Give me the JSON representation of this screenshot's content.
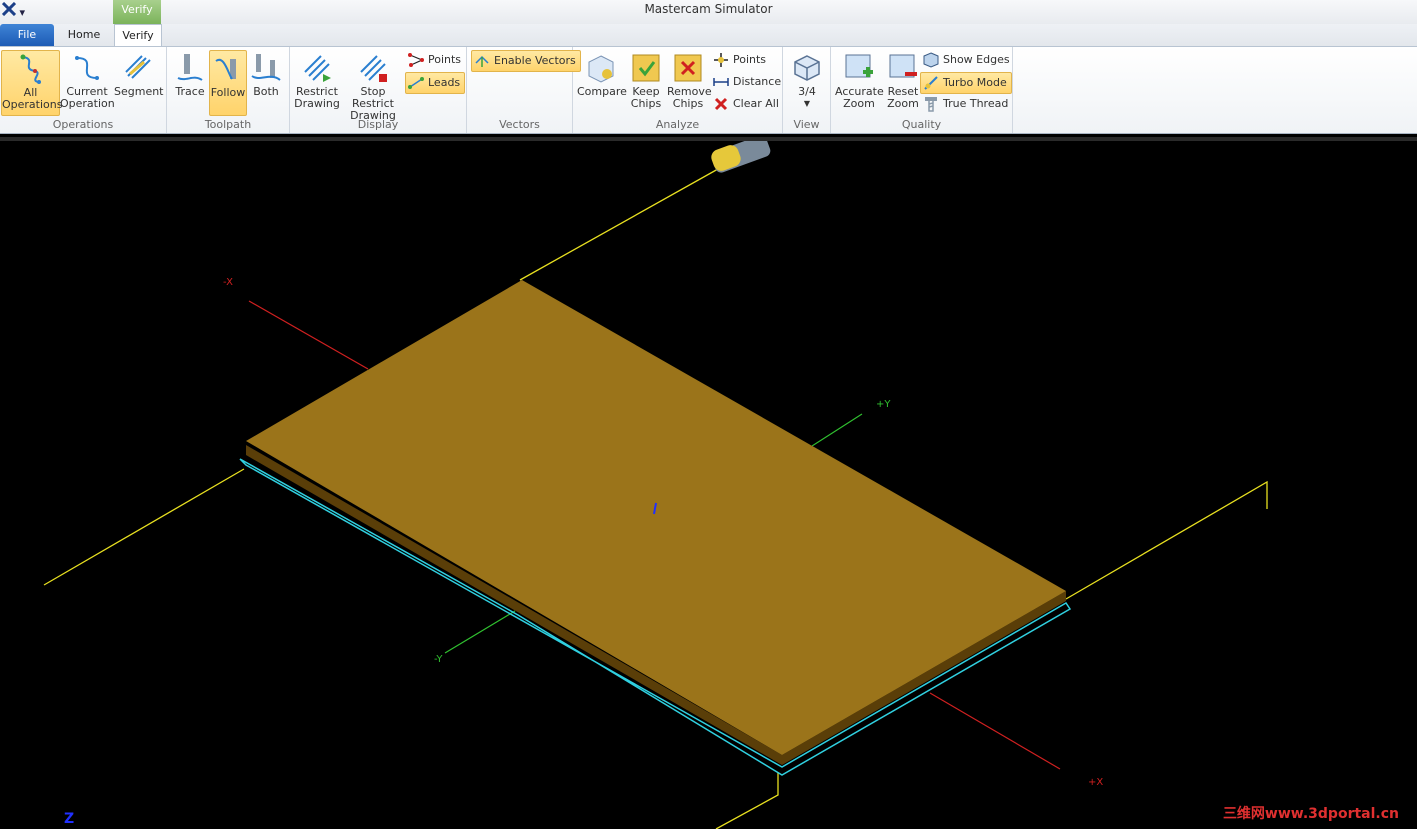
{
  "app": {
    "title": "Mastercam Simulator"
  },
  "qat": {
    "icon": "mastercam-logo-icon",
    "menu_glyph": "▾"
  },
  "context_tab": {
    "label": "Verify"
  },
  "tabs": {
    "file": "File",
    "home": "Home",
    "verify": "Verify"
  },
  "groups": {
    "operations": {
      "label": "Operations",
      "all": "All Operations",
      "current": "Current Operation",
      "segment": "Segment"
    },
    "toolpath": {
      "label": "Toolpath",
      "trace": "Trace",
      "follow": "Follow",
      "both": "Both"
    },
    "display": {
      "label": "Display",
      "restrict": "Restrict Drawing",
      "stop_restrict": "Stop Restrict Drawing",
      "points": "Points",
      "leads": "Leads"
    },
    "vectors": {
      "label": "Vectors",
      "enable": "Enable Vectors"
    },
    "analyze": {
      "label": "Analyze",
      "compare": "Compare",
      "keep_chips": "Keep Chips",
      "remove_chips": "Remove Chips",
      "points": "Points",
      "distance": "Distance",
      "clear_all": "Clear All"
    },
    "view": {
      "label": "View",
      "three_quarter": "3/4"
    },
    "quality": {
      "label": "Quality",
      "accurate_zoom": "Accurate Zoom",
      "reset_zoom": "Reset Zoom",
      "show_edges": "Show Edges",
      "turbo_mode": "Turbo Mode",
      "true_thread": "True Thread"
    }
  },
  "viewport": {
    "axis_labels": {
      "neg_x": "-X",
      "pos_x": "+X",
      "pos_y": "+Y",
      "neg_y": "-Y",
      "z": "Z"
    },
    "stock_color": "#9b741a",
    "watermark": "三维网www.3dportal.cn"
  }
}
